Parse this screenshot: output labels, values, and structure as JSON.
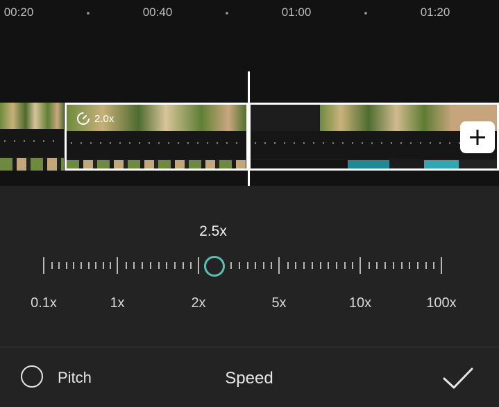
{
  "timeline": {
    "time_labels": [
      "00:20",
      "00:40",
      "01:00",
      "01:20"
    ],
    "clip_speed_badge": "2.0x"
  },
  "speed": {
    "current_value": "2.5x",
    "scale_labels": [
      "0.1x",
      "1x",
      "2x",
      "5x",
      "10x",
      "100x"
    ],
    "accent_color": "#5bbdb4"
  },
  "bottom_bar": {
    "pitch_label": "Pitch",
    "title": "Speed"
  },
  "icons": {
    "speed_badge": "speed-dial-icon",
    "add": "plus-icon",
    "confirm": "check-icon",
    "pitch": "radio-circle-icon"
  }
}
